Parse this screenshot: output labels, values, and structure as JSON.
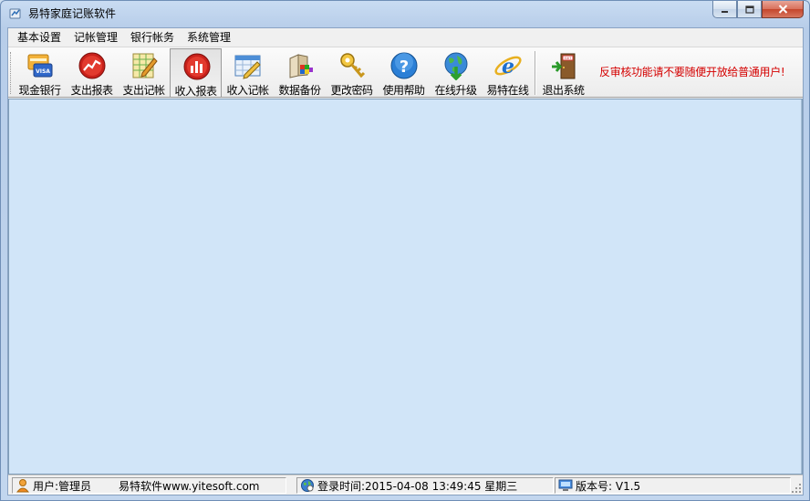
{
  "window": {
    "title": "易特家庭记账软件"
  },
  "menu": [
    "基本设置",
    "记帐管理",
    "银行帐务",
    "系统管理"
  ],
  "toolbar": {
    "buttons": [
      {
        "label": "现金银行",
        "icon": "cash-bank-icon"
      },
      {
        "label": "支出报表",
        "icon": "expense-report-icon"
      },
      {
        "label": "支出记帐",
        "icon": "expense-entry-icon"
      },
      {
        "label": "收入报表",
        "icon": "income-report-icon"
      },
      {
        "label": "收入记帐",
        "icon": "income-entry-icon"
      },
      {
        "label": "数据备份",
        "icon": "data-backup-icon"
      },
      {
        "label": "更改密码",
        "icon": "key-icon"
      },
      {
        "label": "使用帮助",
        "icon": "help-icon"
      },
      {
        "label": "在线升级",
        "icon": "globe-update-icon"
      },
      {
        "label": "易特在线",
        "icon": "internet-explorer-icon"
      },
      {
        "label": "退出系统",
        "icon": "exit-door-icon"
      }
    ],
    "warning": "反审核功能请不要随便开放给普通用户!"
  },
  "status": {
    "user": "用户:管理员",
    "company": "易特软件www.yitesoft.com",
    "login_time": "登录时间:2015-04-08 13:49:45 星期三",
    "version": "版本号: V1.5"
  },
  "colors": {
    "mdi_background": "#d1e5f8",
    "warning_text": "#d40000",
    "close_button": "#c4462c"
  }
}
